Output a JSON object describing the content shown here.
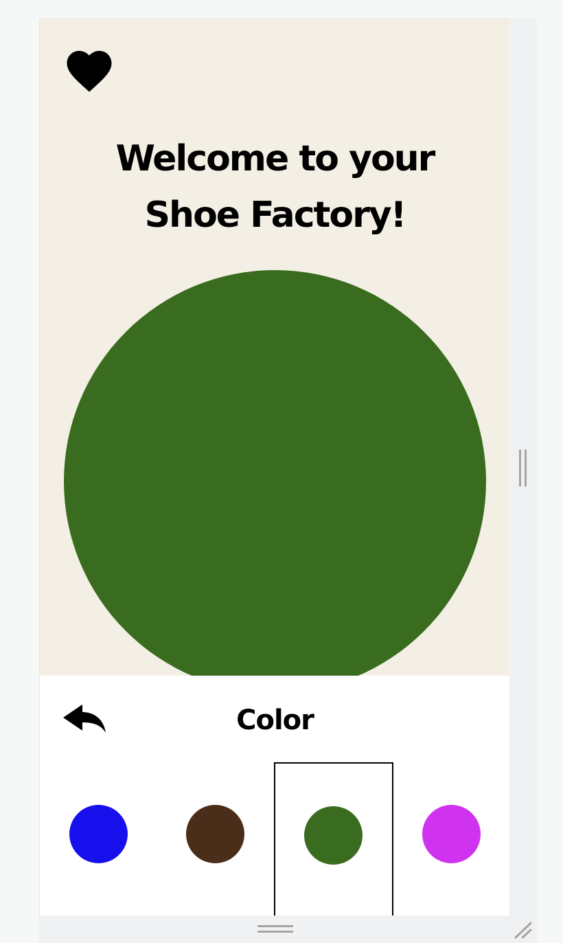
{
  "header": {
    "favorite_icon": "heart-icon",
    "title_line1": "Welcome to your",
    "title_line2": "Shoe Factory!"
  },
  "preview": {
    "shoe_color": "#396c1f"
  },
  "customizer": {
    "back_icon": "reply-arrow-icon",
    "title": "Color",
    "swatches": [
      {
        "color": "#1810ec",
        "selected": false
      },
      {
        "color": "#4b2e19",
        "selected": false
      },
      {
        "color": "#396c1f",
        "selected": true
      },
      {
        "color": "#d033ef",
        "selected": false
      }
    ]
  },
  "frame": {
    "accent_handle_color": "#a4a4a4",
    "frame_background": "#f0f1f3",
    "hero_background": "#f3efe4"
  }
}
